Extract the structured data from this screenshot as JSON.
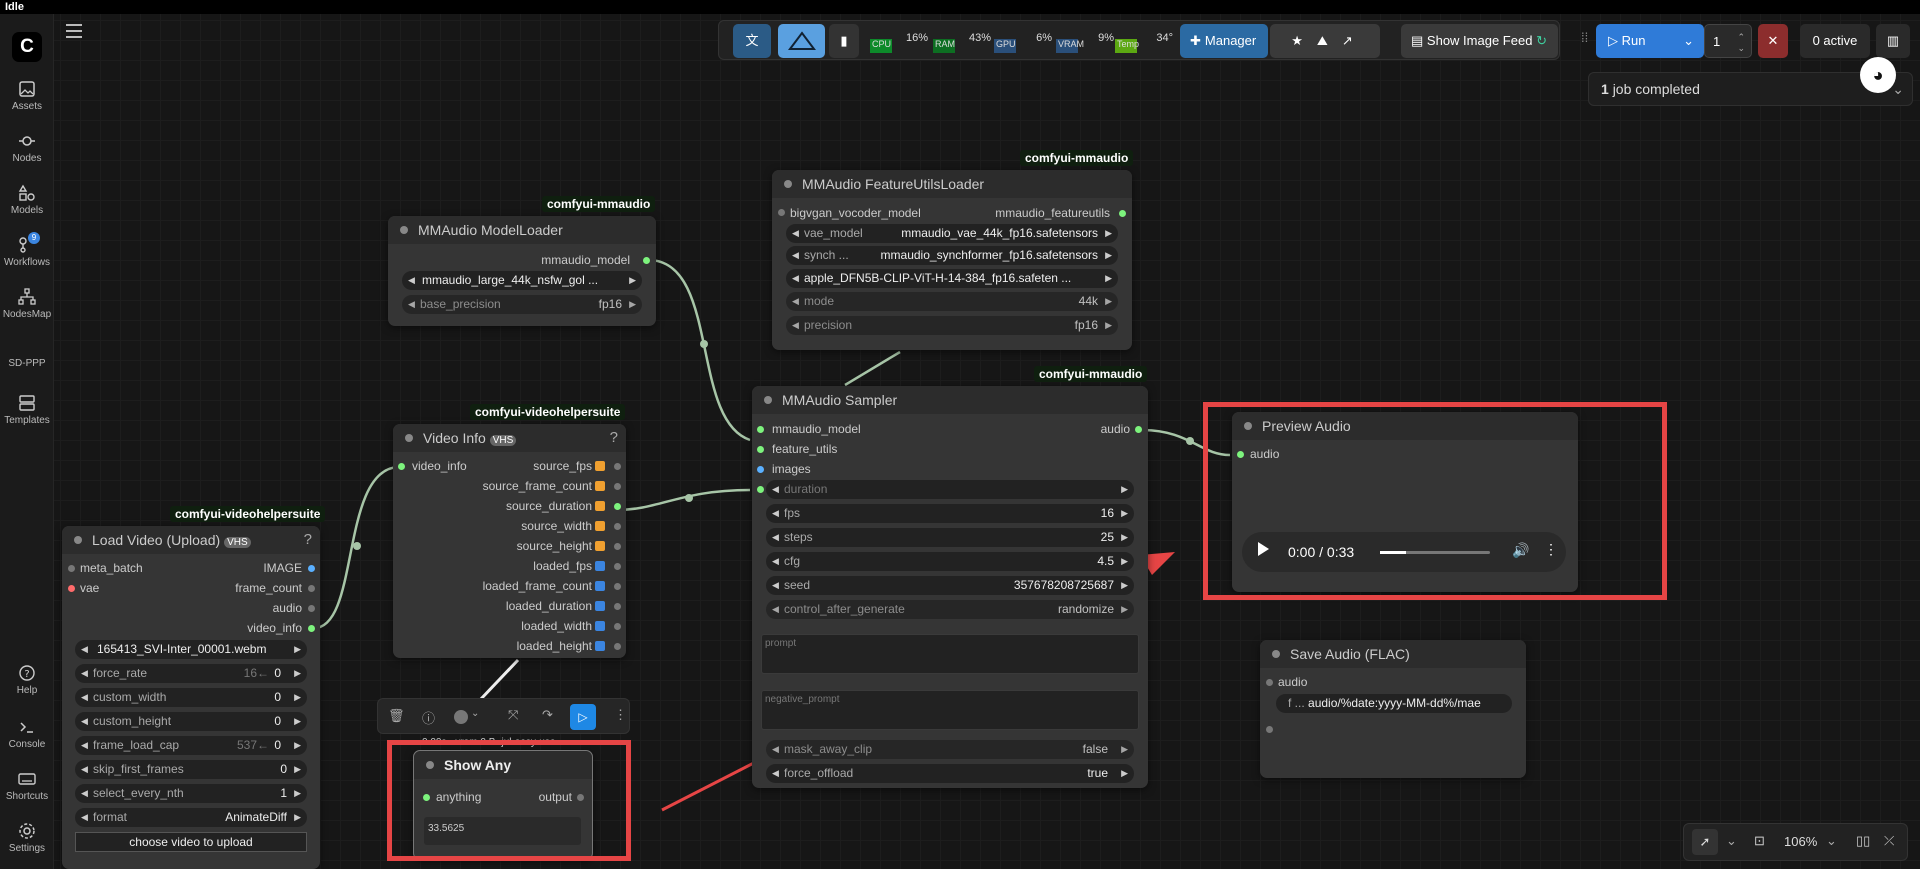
{
  "title": "Idle",
  "sidebar": {
    "items": [
      {
        "label": "Assets"
      },
      {
        "label": "Nodes"
      },
      {
        "label": "Models"
      },
      {
        "label": "Workflows",
        "badge": "9"
      },
      {
        "label": "NodesMap"
      },
      {
        "label": "SD-PPP"
      },
      {
        "label": "Templates"
      },
      {
        "label": "Help"
      },
      {
        "label": "Console"
      },
      {
        "label": "Shortcuts"
      },
      {
        "label": "Settings"
      }
    ]
  },
  "topbar": {
    "stats": [
      {
        "label": "CPU",
        "value": "16%"
      },
      {
        "label": "RAM",
        "value": "43%"
      },
      {
        "label": "GPU",
        "value": "6%"
      },
      {
        "label": "VRAM",
        "value": "9%"
      },
      {
        "label": "Temp",
        "value": "34°"
      }
    ],
    "manager_label": "Manager",
    "show_image_feed": "Show Image Feed",
    "run_label": "Run",
    "batch_count": "1",
    "active_label": "0 active"
  },
  "jobs": {
    "count": "1",
    "label": "job completed"
  },
  "nodes": {
    "modelloader": {
      "badge": "comfyui-mmaudio",
      "title": "MMAudio ModelLoader",
      "output": "mmaudio_model",
      "widgets": [
        {
          "label": "",
          "value": "mmaudio_large_44k_nsfw_gol ..."
        },
        {
          "label": "base_precision",
          "value": "fp16"
        }
      ]
    },
    "featureutils": {
      "badge": "comfyui-mmaudio",
      "title": "MMAudio FeatureUtilsLoader",
      "input": "bigvgan_vocoder_model",
      "output": "mmaudio_featureutils",
      "widgets": [
        {
          "label": "vae_model",
          "value": "mmaudio_vae_44k_fp16.safetensors"
        },
        {
          "label": "synch ...",
          "value": "mmaudio_synchformer_fp16.safetensors"
        },
        {
          "label": "",
          "value": "apple_DFN5B-CLIP-ViT-H-14-384_fp16.safeten ..."
        },
        {
          "label": "mode",
          "value": "44k"
        },
        {
          "label": "precision",
          "value": "fp16"
        }
      ]
    },
    "sampler": {
      "badge": "comfyui-mmaudio",
      "title": "MMAudio Sampler",
      "inputs": [
        "mmaudio_model",
        "feature_utils",
        "images",
        "duration"
      ],
      "output": "audio",
      "widgets": [
        {
          "label": "fps",
          "value": "16"
        },
        {
          "label": "steps",
          "value": "25"
        },
        {
          "label": "cfg",
          "value": "4.5"
        },
        {
          "label": "seed",
          "value": "357678208725687"
        },
        {
          "label": "control_after_generate",
          "value": "randomize"
        }
      ],
      "prompt_placeholder": "prompt",
      "negative_placeholder": "negative_prompt",
      "toggles": [
        {
          "label": "mask_away_clip",
          "value": "false"
        },
        {
          "label": "force_offload",
          "value": "true"
        }
      ]
    },
    "videoinfo": {
      "badge": "comfyui-videohelpersuite",
      "title": "Video Info",
      "tag": "VHS",
      "input": "video_info",
      "outputs": [
        "source_fps",
        "source_frame_count",
        "source_duration",
        "source_width",
        "source_height",
        "loaded_fps",
        "loaded_frame_count",
        "loaded_duration",
        "loaded_width",
        "loaded_height"
      ]
    },
    "loadvideo": {
      "badge": "comfyui-videohelpersuite",
      "title": "Load Video (Upload)",
      "tag": "VHS",
      "inputs": [
        "meta_batch",
        "vae"
      ],
      "outputs": [
        "IMAGE",
        "frame_count",
        "audio",
        "video_info"
      ],
      "widgets": [
        {
          "label": "",
          "value": "165413_SVI-Inter_00001.webm"
        },
        {
          "label": "force_rate",
          "value": "0",
          "hint": "16←"
        },
        {
          "label": "custom_width",
          "value": "0"
        },
        {
          "label": "custom_height",
          "value": "0"
        },
        {
          "label": "frame_load_cap",
          "value": "0",
          "hint": "537←"
        },
        {
          "label": "skip_first_frames",
          "value": "0"
        },
        {
          "label": "select_every_nth",
          "value": "1"
        },
        {
          "label": "format",
          "value": "AnimateDiff"
        }
      ],
      "upload": "choose video to upload"
    },
    "showany": {
      "caption": "0.00s - vram 0 B -jul-easy-use",
      "title": "Show Any",
      "input": "anything",
      "output": "output",
      "value": "33.5625"
    },
    "preview": {
      "title": "Preview Audio",
      "input": "audio",
      "time": "0:00 / 0:33"
    },
    "saveaudio": {
      "title": "Save Audio (FLAC)",
      "input": "audio",
      "prefix_label": "f ...",
      "prefix_value": "audio/%date:yyyy-MM-dd%/mae"
    }
  },
  "zoom": "106%",
  "colors": {
    "accent": "#2f7bd8",
    "highlight": "#e64545",
    "socket": "#7df37d"
  }
}
